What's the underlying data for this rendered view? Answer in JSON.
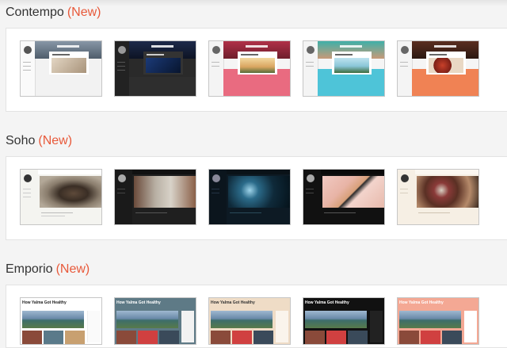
{
  "sections": [
    {
      "name": "Contempo",
      "badge": "(New)"
    },
    {
      "name": "Soho",
      "badge": "(New)"
    },
    {
      "name": "Emporio",
      "badge": "(New)"
    }
  ],
  "emporio_thumbnail_heading": "How Yalma Got Healthy",
  "colors": {
    "badge": "#e8593a",
    "contempo_themes": [
      "#f2f2f2",
      "#2a2a2a",
      "#e96b80",
      "#4ec4d8",
      "#f08254"
    ],
    "soho_themes": [
      "#f4f4f0",
      "#1f1f1f",
      "#0d1a24",
      "#111111",
      "#f6efe4"
    ],
    "emporio_themes": [
      "#ffffff",
      "#5e7a86",
      "#efdcc6",
      "#111111",
      "#f4a894"
    ]
  }
}
